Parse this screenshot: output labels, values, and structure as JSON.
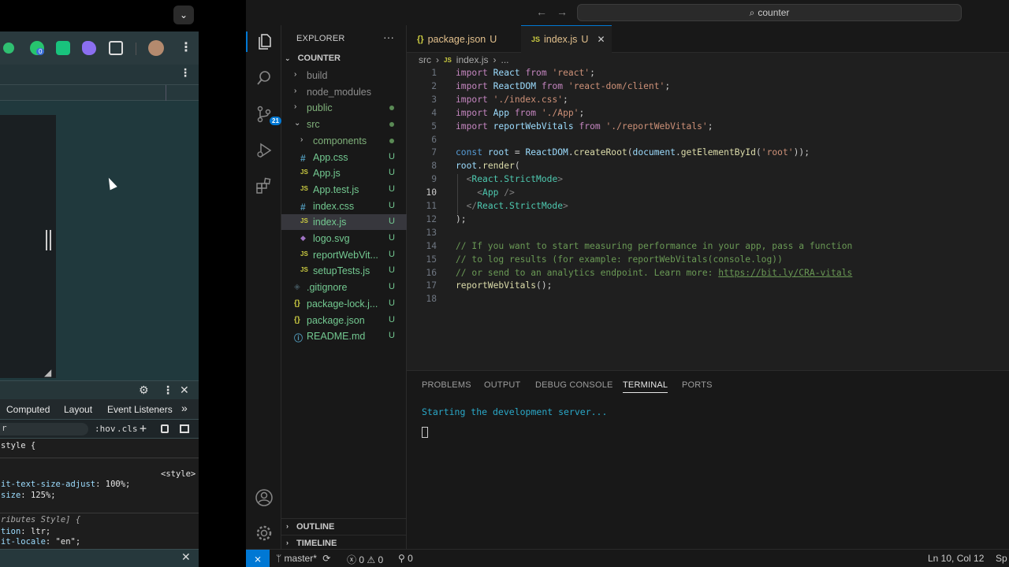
{
  "browser": {
    "tab_dropdown": "⌄",
    "extensions": [
      {
        "icon": "green-eye-icon",
        "color": "#2fbf71"
      },
      {
        "icon": "grammar-extension-icon",
        "color": "#27c46e",
        "badge": "0"
      },
      {
        "icon": "chatgpt-extension-icon",
        "color": "#19c37d"
      },
      {
        "icon": "purple-cloud-icon",
        "color": "#8b6ff0"
      },
      {
        "icon": "puzzle-icon",
        "color": "#dddddd"
      }
    ],
    "devtools": {
      "tabs": [
        "Computed",
        "Layout",
        "Event Listeners",
        "»"
      ],
      "filter_value": "r",
      "filter_tools": [
        ":hov",
        ".cls",
        "+"
      ],
      "style_lines": [
        {
          "text": "style {"
        },
        {
          "text": "<style>"
        },
        {
          "prop": "it-text-size-adjust",
          "val": ": 100%;"
        },
        {
          "prop": "size",
          "val": ": 125%;"
        },
        {
          "text": "ributes Style] {"
        },
        {
          "prop": "tion",
          "val": ": ltr;"
        },
        {
          "prop": "it-locale",
          "val": ": \"en\";"
        }
      ]
    }
  },
  "vscode": {
    "command_center": "counter",
    "scm_badge": "21",
    "explorer": {
      "title": "EXPLORER",
      "more": "···",
      "folder": "COUNTER",
      "items": [
        {
          "name": "build",
          "type": "folder",
          "status": ""
        },
        {
          "name": "node_modules",
          "type": "folder",
          "status": ""
        },
        {
          "name": "public",
          "type": "folder",
          "status": "dot"
        },
        {
          "name": "src",
          "type": "folder-open",
          "status": "dot"
        },
        {
          "name": "components",
          "type": "folder",
          "status": "dot"
        },
        {
          "name": "App.css",
          "type": "css",
          "status": "U"
        },
        {
          "name": "App.js",
          "type": "js",
          "status": "U"
        },
        {
          "name": "App.test.js",
          "type": "js",
          "status": "U"
        },
        {
          "name": "index.css",
          "type": "css",
          "status": "U"
        },
        {
          "name": "index.js",
          "type": "js",
          "status": "U",
          "selected": true
        },
        {
          "name": "logo.svg",
          "type": "svg",
          "status": "U"
        },
        {
          "name": "reportWebVit...",
          "type": "js",
          "status": "U"
        },
        {
          "name": "setupTests.js",
          "type": "js",
          "status": "U"
        },
        {
          "name": ".gitignore",
          "type": "git",
          "status": "U"
        },
        {
          "name": "package-lock.j...",
          "type": "json",
          "status": "U"
        },
        {
          "name": "package.json",
          "type": "json",
          "status": "U"
        },
        {
          "name": "README.md",
          "type": "info",
          "status": "U"
        }
      ],
      "sections": [
        "OUTLINE",
        "TIMELINE"
      ]
    },
    "tabs": [
      {
        "icon": "{}",
        "label": "package.json",
        "status": "U",
        "active": false
      },
      {
        "icon": "JS",
        "label": "index.js",
        "status": "U",
        "active": true,
        "close": "✕"
      }
    ],
    "breadcrumb": {
      "folder": "src",
      "sep": "›",
      "file_icon": "JS",
      "file": "index.js",
      "more": "..."
    },
    "current_line": 10,
    "code_lines": [
      [
        [
          "kw",
          "import"
        ],
        [
          "",
          " "
        ],
        [
          "var",
          "React"
        ],
        [
          "",
          " "
        ],
        [
          "kw",
          "from"
        ],
        [
          "",
          " "
        ],
        [
          "str",
          "'react'"
        ],
        [
          "",
          ";"
        ]
      ],
      [
        [
          "kw",
          "import"
        ],
        [
          "",
          " "
        ],
        [
          "var",
          "ReactDOM"
        ],
        [
          "",
          " "
        ],
        [
          "kw",
          "from"
        ],
        [
          "",
          " "
        ],
        [
          "str",
          "'react-dom/client'"
        ],
        [
          "",
          ";"
        ]
      ],
      [
        [
          "kw",
          "import"
        ],
        [
          "",
          " "
        ],
        [
          "str",
          "'./index.css'"
        ],
        [
          "",
          ";"
        ]
      ],
      [
        [
          "kw",
          "import"
        ],
        [
          "",
          " "
        ],
        [
          "var",
          "App"
        ],
        [
          "",
          " "
        ],
        [
          "kw",
          "from"
        ],
        [
          "",
          " "
        ],
        [
          "str",
          "'./App'"
        ],
        [
          "",
          ";"
        ]
      ],
      [
        [
          "kw",
          "import"
        ],
        [
          "",
          " "
        ],
        [
          "var",
          "reportWebVitals"
        ],
        [
          "",
          " "
        ],
        [
          "kw",
          "from"
        ],
        [
          "",
          " "
        ],
        [
          "str",
          "'./reportWebVitals'"
        ],
        [
          "",
          ";"
        ]
      ],
      [],
      [
        [
          "kw2",
          "const"
        ],
        [
          "",
          " "
        ],
        [
          "var",
          "root"
        ],
        [
          "",
          " = "
        ],
        [
          "var",
          "ReactDOM"
        ],
        [
          "",
          "."
        ],
        [
          "fn",
          "createRoot"
        ],
        [
          "",
          "("
        ],
        [
          "var",
          "document"
        ],
        [
          "",
          "."
        ],
        [
          "fn",
          "getElementById"
        ],
        [
          "",
          "("
        ],
        [
          "str",
          "'root'"
        ],
        [
          "",
          "));"
        ]
      ],
      [
        [
          "var",
          "root"
        ],
        [
          "",
          "."
        ],
        [
          "fn",
          "render"
        ],
        [
          "",
          "("
        ]
      ],
      [
        [
          "",
          "  "
        ],
        [
          "br",
          "<"
        ],
        [
          "tg",
          "React.StrictMode"
        ],
        [
          "br",
          ">"
        ]
      ],
      [
        [
          "",
          "    "
        ],
        [
          "br",
          "<"
        ],
        [
          "tg",
          "App"
        ],
        [
          "",
          " "
        ],
        [
          "br",
          "/>"
        ]
      ],
      [
        [
          "",
          "  "
        ],
        [
          "br",
          "</"
        ],
        [
          "tg",
          "React.StrictMode"
        ],
        [
          "br",
          ">"
        ]
      ],
      [
        [
          "",
          ");"
        ]
      ],
      [],
      [
        [
          "cm",
          "// If you want to start measuring performance in your app, pass a function"
        ]
      ],
      [
        [
          "cm",
          "// to log results (for example: reportWebVitals(console.log))"
        ]
      ],
      [
        [
          "cm",
          "// or send to an analytics endpoint. Learn more: "
        ],
        [
          "link",
          "https://bit.ly/CRA-vitals"
        ]
      ],
      [
        [
          "fn",
          "reportWebVitals"
        ],
        [
          "",
          "();"
        ]
      ],
      []
    ],
    "panel": {
      "tabs": [
        "PROBLEMS",
        "OUTPUT",
        "DEBUG CONSOLE",
        "TERMINAL",
        "PORTS"
      ],
      "active_tab": "TERMINAL",
      "terminal_line": "Starting the development server..."
    },
    "status": {
      "remote": "⨯",
      "branch": "master*",
      "errors": "0",
      "warnings": "0",
      "ports": "0",
      "position": "Ln 10, Col 12",
      "spaces": "Sp"
    }
  }
}
